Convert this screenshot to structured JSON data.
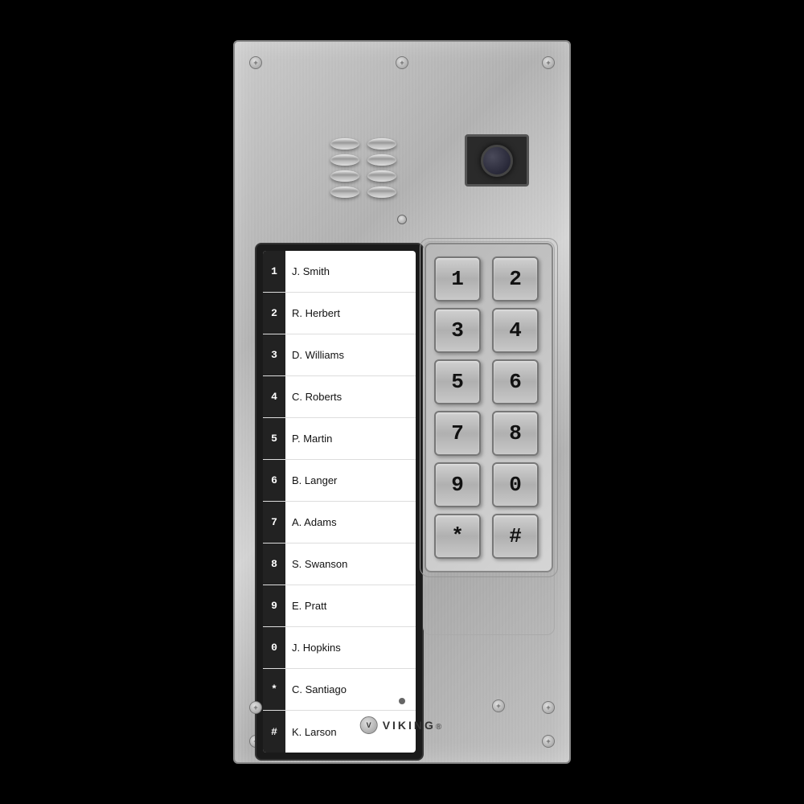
{
  "panel": {
    "brand": "VIKING",
    "brand_symbol": "®"
  },
  "directory": {
    "entries": [
      {
        "key": "1",
        "name": "J. Smith"
      },
      {
        "key": "2",
        "name": "R. Herbert"
      },
      {
        "key": "3",
        "name": "D. Williams"
      },
      {
        "key": "4",
        "name": "C. Roberts"
      },
      {
        "key": "5",
        "name": "P. Martin"
      },
      {
        "key": "6",
        "name": "B. Langer"
      },
      {
        "key": "7",
        "name": "A. Adams"
      },
      {
        "key": "8",
        "name": "S. Swanson"
      },
      {
        "key": "9",
        "name": "E. Pratt"
      },
      {
        "key": "0",
        "name": "J. Hopkins"
      },
      {
        "key": "*",
        "name": "C. Santiago"
      },
      {
        "key": "#",
        "name": "K. Larson"
      }
    ]
  },
  "keypad": {
    "keys": [
      "1",
      "2",
      "3",
      "4",
      "5",
      "6",
      "7",
      "8",
      "9",
      "0",
      "*",
      "#"
    ]
  },
  "speaker": {
    "rows": 4,
    "bumps_per_row": 2
  }
}
